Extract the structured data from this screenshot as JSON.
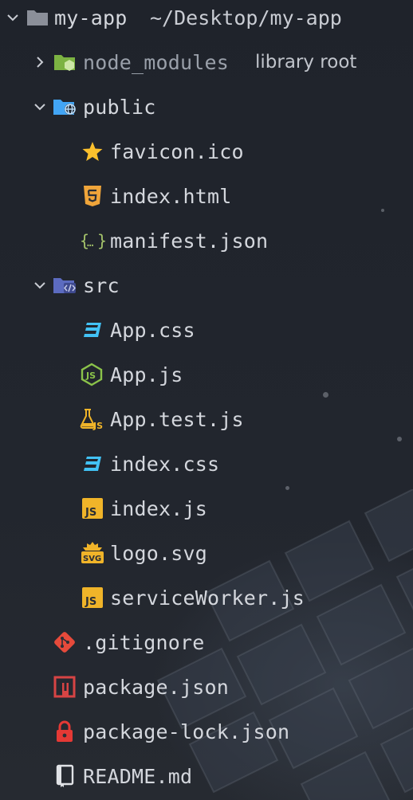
{
  "explorer": {
    "root": {
      "name": "my-app",
      "path": "~/Desktop/my-app",
      "expanded": true
    },
    "items": [
      {
        "label": "node_modules",
        "description": "library root",
        "type": "folder",
        "expanded": false,
        "icon": "nodejs-folder-icon"
      },
      {
        "label": "public",
        "type": "folder",
        "expanded": true,
        "icon": "globe-folder-icon"
      },
      {
        "label": "favicon.ico",
        "type": "file",
        "icon": "star-icon"
      },
      {
        "label": "index.html",
        "type": "file",
        "icon": "html5-icon"
      },
      {
        "label": "manifest.json",
        "type": "file",
        "icon": "json-braces-icon"
      },
      {
        "label": "src",
        "type": "folder",
        "expanded": true,
        "icon": "code-folder-icon"
      },
      {
        "label": "App.css",
        "type": "file",
        "icon": "css3-icon"
      },
      {
        "label": "App.js",
        "type": "file",
        "icon": "nodejs-hex-icon"
      },
      {
        "label": "App.test.js",
        "type": "file",
        "icon": "test-flask-icon"
      },
      {
        "label": "index.css",
        "type": "file",
        "icon": "css3-icon"
      },
      {
        "label": "index.js",
        "type": "file",
        "icon": "js-icon"
      },
      {
        "label": "logo.svg",
        "type": "file",
        "icon": "svg-icon"
      },
      {
        "label": "serviceWorker.js",
        "type": "file",
        "icon": "js-icon"
      },
      {
        "label": ".gitignore",
        "type": "file",
        "icon": "git-icon"
      },
      {
        "label": "package.json",
        "type": "file",
        "icon": "npm-icon"
      },
      {
        "label": "package-lock.json",
        "type": "file",
        "icon": "lock-icon"
      },
      {
        "label": "README.md",
        "type": "file",
        "icon": "readme-book-icon"
      }
    ]
  },
  "colors": {
    "background": "#1f232b",
    "text": "#d4d7dd",
    "muted_text": "#9aa0aa",
    "folder_gray": "#8b8f99",
    "folder_green": "#7cb342",
    "folder_blue": "#42a5f5",
    "folder_indigo": "#5c6bc0",
    "js_yellow": "#f0b429",
    "html_orange": "#f0a53a",
    "css_blue": "#42c2f5",
    "node_green": "#8bc34a",
    "git_red": "#e64a3b",
    "npm_red": "#d74444"
  }
}
